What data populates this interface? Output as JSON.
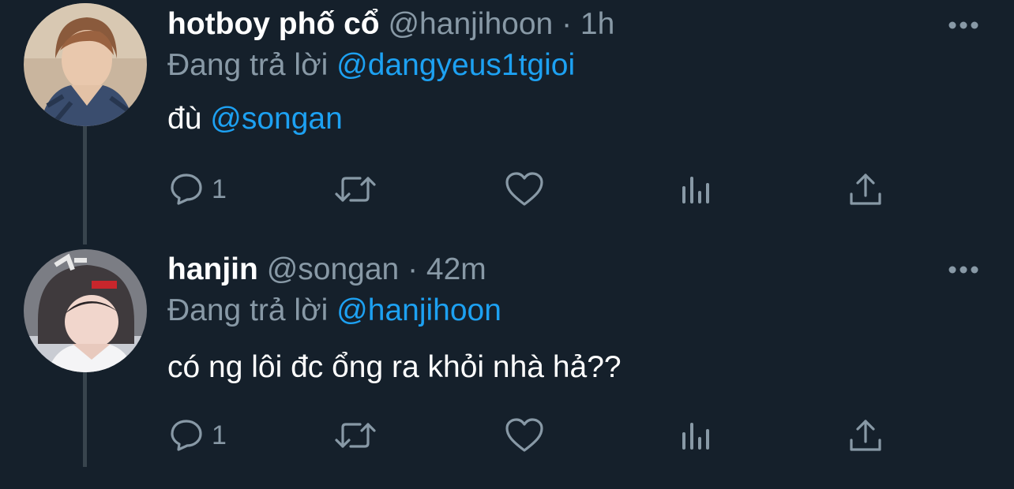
{
  "theme": {
    "background": "#15202b",
    "text": "#ffffff",
    "muted": "#8899a6",
    "link": "#1da1f2",
    "thread_line": "#38444d"
  },
  "tweets": [
    {
      "display_name": "hotboy phố cổ",
      "handle": "@hanjihoon",
      "separator": "·",
      "time": "1h",
      "reply_prefix": "Đang trả lời",
      "reply_to": "@dangyeus1tgioi",
      "body_text": "đù",
      "body_mention": "@songan",
      "reply_count": "1",
      "avatar_icon": "profile-photo"
    },
    {
      "display_name": "hanjin",
      "handle": "@songan",
      "separator": "·",
      "time": "42m",
      "reply_prefix": "Đang trả lời",
      "reply_to": "@hanjihoon",
      "body_text": "có ng lôi đc ổng ra khỏi nhà hả??",
      "body_mention": "",
      "reply_count": "1",
      "avatar_icon": "profile-photo"
    }
  ],
  "icons": {
    "reply": "speech-bubble-icon",
    "retweet": "retweet-arrows-icon",
    "like": "heart-icon",
    "stats": "bar-chart-icon",
    "share": "upload-icon",
    "more": "ellipsis-icon"
  }
}
